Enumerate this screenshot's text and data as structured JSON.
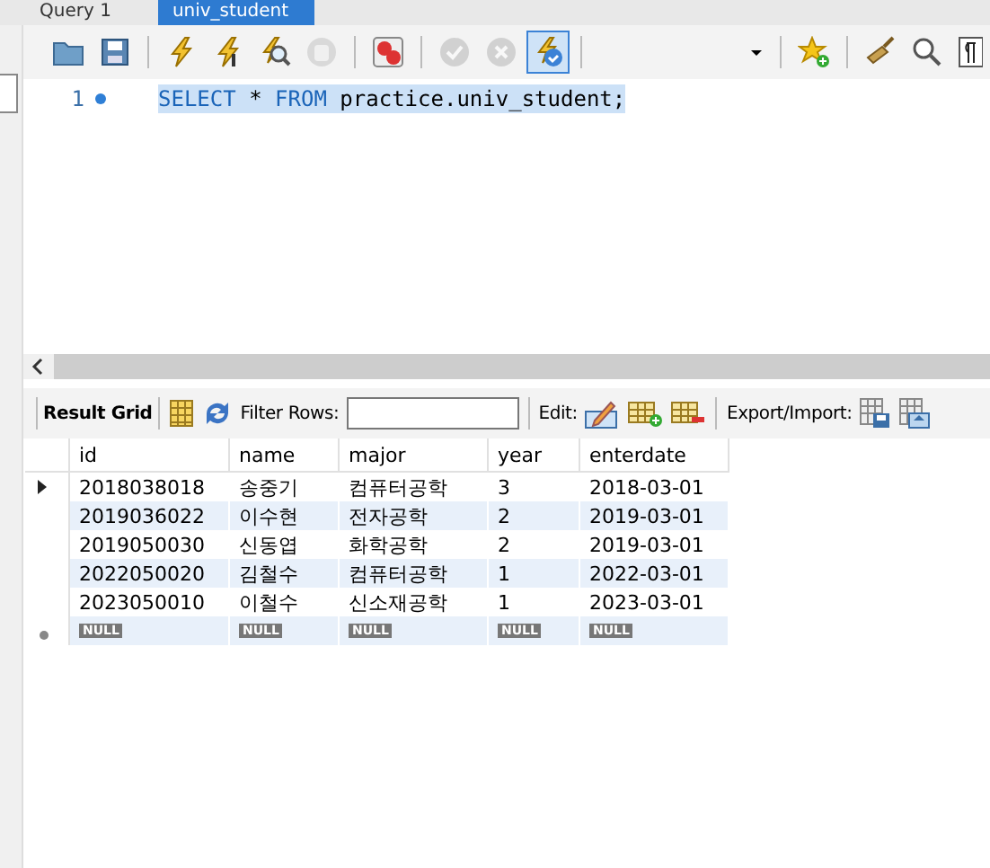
{
  "tabs": [
    {
      "label": "Query 1",
      "selected": false
    },
    {
      "label": "univ_student",
      "selected": true
    }
  ],
  "toolbar": [
    {
      "kind": "open",
      "disabled": false,
      "selected": false
    },
    {
      "kind": "save",
      "disabled": false,
      "selected": false
    },
    {
      "kind": "sep"
    },
    {
      "kind": "execute",
      "disabled": false,
      "selected": false
    },
    {
      "kind": "execute-current",
      "disabled": false,
      "selected": false
    },
    {
      "kind": "explain",
      "disabled": false,
      "selected": false
    },
    {
      "kind": "stop",
      "disabled": true,
      "selected": false
    },
    {
      "kind": "sep"
    },
    {
      "kind": "stop-on-error",
      "disabled": false,
      "selected": false
    },
    {
      "kind": "sep"
    },
    {
      "kind": "commit",
      "disabled": true,
      "selected": false
    },
    {
      "kind": "rollback",
      "disabled": true,
      "selected": false
    },
    {
      "kind": "autocommit",
      "disabled": false,
      "selected": true
    },
    {
      "kind": "sep"
    }
  ],
  "toolbar_right": [
    {
      "kind": "dropdown"
    },
    {
      "kind": "sep"
    },
    {
      "kind": "bookmark"
    },
    {
      "kind": "sep"
    },
    {
      "kind": "beautify"
    },
    {
      "kind": "find"
    },
    {
      "kind": "invisibles"
    }
  ],
  "editor": {
    "lines": [
      {
        "number": "1",
        "marked": true,
        "tokens": [
          {
            "kind": "keyword",
            "text": "SELECT"
          },
          {
            "kind": "plain",
            "text": " * "
          },
          {
            "kind": "keyword",
            "text": "FROM"
          },
          {
            "kind": "plain",
            "text": " practice.univ_student;"
          }
        ]
      }
    ]
  },
  "result_toolbar": {
    "title": "Result Grid",
    "filter_label": "Filter Rows:",
    "edit_label": "Edit:",
    "export_label": "Export/Import:"
  },
  "grid": {
    "columns": [
      "id",
      "name",
      "major",
      "year",
      "enterdate"
    ],
    "rows": [
      {
        "current": true,
        "cells": [
          "2018038018",
          "송중기",
          "컴퓨터공학",
          "3",
          "2018-03-01"
        ]
      },
      {
        "current": false,
        "cells": [
          "2019036022",
          "이수현",
          "전자공학",
          "2",
          "2019-03-01"
        ]
      },
      {
        "current": false,
        "cells": [
          "2019050030",
          "신동엽",
          "화학공학",
          "2",
          "2019-03-01"
        ]
      },
      {
        "current": false,
        "cells": [
          "2022050020",
          "김철수",
          "컴퓨터공학",
          "1",
          "2022-03-01"
        ]
      },
      {
        "current": false,
        "cells": [
          "2023050010",
          "이철수",
          "신소재공학",
          "1",
          "2023-03-01"
        ]
      }
    ],
    "new_row": [
      "NULL",
      "NULL",
      "NULL",
      "NULL",
      "NULL"
    ]
  }
}
